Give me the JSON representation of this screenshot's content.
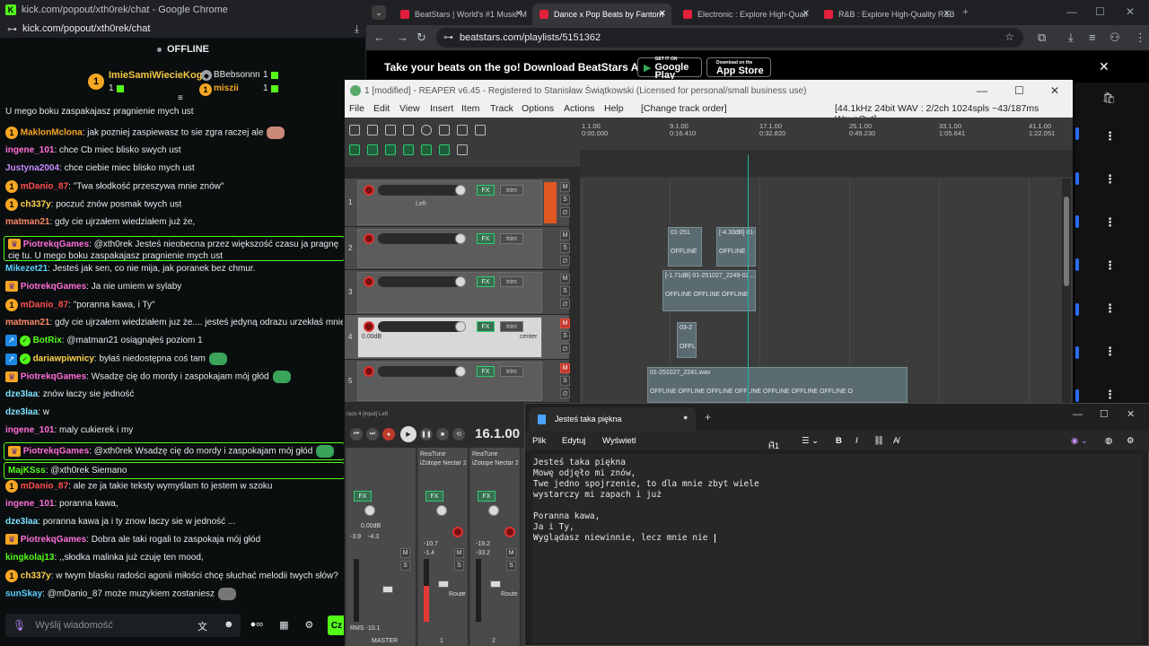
{
  "chat_window": {
    "title": "kick.com/popout/xth0rek/chat - Google Chrome",
    "url": "kick.com/popout/xth0rek/chat",
    "status": "OFFLINE",
    "top_gifters": [
      {
        "rank": "1",
        "name": "ImieSamiWiecieKogo",
        "count": "1"
      },
      {
        "rank": "",
        "name": "BBebsonnn",
        "count": "1"
      },
      {
        "rank": "",
        "name": "miszii",
        "count": "1"
      }
    ],
    "messages": [
      {
        "user": "",
        "text": "U mego boku zaspakajasz pragnienie mych ust",
        "color": "#e8eaed",
        "badge": ""
      },
      {
        "user": "MaklonMclona",
        "text": ": jak pozniej zaspiewasz to sie zgra raczej ale",
        "color": "#f5a623",
        "badge": "coin"
      },
      {
        "user": "ingene_101",
        "text": ": chce Cb miec blisko swych ust",
        "color": "#ff6fd8",
        "badge": ""
      },
      {
        "user": "Justyna2004",
        "text": ": chce ciebie miec blisko mych ust",
        "color": "#c38cff",
        "badge": ""
      },
      {
        "user": "mDanio_87",
        "text": ": \"Twa słodkość przeszywa mnie znów\"",
        "color": "#ff4d4d",
        "badge": "coin"
      },
      {
        "user": "ch337y",
        "text": ": poczuć znów posmak twych ust",
        "color": "#ffd54d",
        "badge": "coin"
      },
      {
        "user": "matman21",
        "text": ": gdy cie ujrzałem wiedziałem już że,",
        "color": "#ff8a65",
        "badge": ""
      },
      {
        "user": "PiotrekqGames",
        "text": ": @xth0rek Jesteś nieobecna przez większość czasu ja pragnę cię tu. U mego boku zaspakajasz pragnienie mych ust",
        "color": "#ff6fd8",
        "badge": "crown"
      },
      {
        "user": "Mikezet21",
        "text": ": Jesteś jak sen, co nie mija, jak poranek bez chmur.",
        "color": "#5ad1ff",
        "badge": ""
      },
      {
        "user": "PiotrekqGames",
        "text": ": Ja nie umiem w sylaby",
        "color": "#ff6fd8",
        "badge": "crown"
      },
      {
        "user": "mDanio_87",
        "text": ": \"poranna kawa, i Ty\"",
        "color": "#ff4d4d",
        "badge": "coin"
      },
      {
        "user": "matman21",
        "text": ": gdy cie ujrzałem wiedziałem juz że.... jesteś jedyną odrazu urzekłaś mnie",
        "color": "#ff8a65",
        "badge": ""
      },
      {
        "user": "BotRix",
        "text": ": @matman21 osiągnąłeś poziom 1",
        "color": "#53fc18",
        "badge": "bot"
      },
      {
        "user": "dariawpiwnicy",
        "text": ": byłaś niedostępna coś tam",
        "color": "#ffd54d",
        "badge": "bot"
      },
      {
        "user": "PiotrekqGames",
        "text": ": Wsadzę cię do mordy i zaspokajam mój głód",
        "color": "#ff6fd8",
        "badge": "crown"
      },
      {
        "user": "dze3laa",
        "text": ": znów łaczy sie jedność",
        "color": "#7ee3ff",
        "badge": ""
      },
      {
        "user": "dze3laa",
        "text": ": w",
        "color": "#7ee3ff",
        "badge": ""
      },
      {
        "user": "ingene_101",
        "text": ": maly cukierek i my",
        "color": "#ff6fd8",
        "badge": ""
      },
      {
        "user": "PiotrekqGames",
        "text": ": @xth0rek Wsadzę cię do mordy i zaspokajam mój głód",
        "color": "#ff6fd8",
        "badge": "crown"
      },
      {
        "user": "MajKSss",
        "text": ": @xth0rek Siemano",
        "color": "#53fc18",
        "badge": ""
      },
      {
        "user": "mDanio_87",
        "text": ": ale ze ja takie teksty wymyślam to jestem w szoku",
        "color": "#ff4d4d",
        "badge": "coin"
      },
      {
        "user": "ingene_101",
        "text": ": poranna kawa,",
        "color": "#ff6fd8",
        "badge": ""
      },
      {
        "user": "dze3laa",
        "text": ": poranna kawa ja i ty znow laczy sie w jedność ...",
        "color": "#7ee3ff",
        "badge": ""
      },
      {
        "user": "PiotrekqGames",
        "text": ": Dobra ale taki rogali to zaspokaja mój głód",
        "color": "#ff6fd8",
        "badge": "crown"
      },
      {
        "user": "kingkolaj13",
        "text": ": ,,słodka malinka już czuję ten mood,",
        "color": "#53fc18",
        "badge": ""
      },
      {
        "user": "ch337y",
        "text": ": w twym blasku radości agonii miłości chcę słuchać melodii twych słów?",
        "color": "#ffd54d",
        "badge": "coin"
      },
      {
        "user": "sunSkay",
        "text": ": @mDanio_87 może muzykiem zostaniesz",
        "color": "#5ad1ff",
        "badge": ""
      }
    ],
    "input_placeholder": "Wyślij wiadomość",
    "send_label": "Cz"
  },
  "browser": {
    "tabs": [
      {
        "label": "BeatStars | World's #1 Music M"
      },
      {
        "label": "Dance x Pop Beats by Fantom"
      },
      {
        "label": "Electronic : Explore High-Quali"
      },
      {
        "label": "R&B : Explore High-Quality R&B"
      }
    ],
    "url": "beatstars.com/playlists/5151362",
    "promo_text": "Take your beats on the go! Download BeatStars App",
    "google_play": {
      "small": "GET IT ON",
      "big": "Google Play"
    },
    "app_store": {
      "small": "Download on the",
      "big": "App Store"
    }
  },
  "reaper": {
    "title": "1 [modified] - REAPER v6.45 - Registered to Stanisław Świątkowski (Licensed for personal/small business use)",
    "menu": [
      "File",
      "Edit",
      "View",
      "Insert",
      "Item",
      "Track",
      "Options",
      "Actions",
      "Help",
      "[Change track order]"
    ],
    "status": "[44.1kHz 24bit WAV : 2/2ch 1024spls ~43/187ms WaveOut]",
    "ruler": [
      {
        "bar": "1.1.00",
        "time": "0:00.000"
      },
      {
        "bar": "9.1.00",
        "time": "0:16.410"
      },
      {
        "bar": "17.1.00",
        "time": "0:32.820"
      },
      {
        "bar": "25.1.00",
        "time": "0:49.230"
      },
      {
        "bar": "33.1.00",
        "time": "1:05.641"
      },
      {
        "bar": "41.1.00",
        "time": "1:22.051"
      }
    ],
    "tracks": [
      {
        "num": "1",
        "pan": "Left",
        "vol": ""
      },
      {
        "num": "2",
        "pan": "",
        "vol": ""
      },
      {
        "num": "3",
        "pan": "",
        "vol": ""
      },
      {
        "num": "4",
        "pan": "center",
        "vol": "0.00dB"
      },
      {
        "num": "5",
        "pan": "",
        "vol": ""
      }
    ],
    "items": [
      {
        "label": "01-251",
        "off": "OFFLINE"
      },
      {
        "label": "[-4.33dB] 01-",
        "off": "OFFLINE"
      },
      {
        "label": "[-1.71dB] 01-251027_2249-02...",
        "off": "OFFLINE   OFFLINE   OFFLINE"
      },
      {
        "label": "03-2",
        "off": "OFFL"
      },
      {
        "label": "01-251027_2241.wav",
        "off": "OFFLINE   OFFLINE   OFFLINE   OFFLINE   OFFLINE   OFFLINE   OFFLINE   O"
      }
    ],
    "fx_label": "FX",
    "trim_label": "trim",
    "time_display": "16.1.00",
    "transport_status": "rack 4 [input] Left",
    "mixer": {
      "strips": [
        {
          "name": "MASTER",
          "db": "0.00dB",
          "l": "-3.9",
          "r": "-4.3",
          "rms": "RMS",
          "rmsv": "-10.1"
        },
        {
          "name": "1",
          "plugin1": "ReaTune",
          "plugin2": "iZotope Nectar 2",
          "db": "-10.7",
          "r": "-1.4"
        },
        {
          "name": "2",
          "plugin1": "ReaTune",
          "plugin2": "iZotope Nectar 2",
          "db": "-19.2",
          "r": "-33.2"
        }
      ],
      "route": "Route"
    }
  },
  "notepad": {
    "tab_title": "Jesteś taka piękna",
    "menu": [
      "Plik",
      "Edytuj",
      "Wyświetl"
    ],
    "heading": "H1",
    "lines": [
      "Jesteś taka piękna",
      "Mowę odjęło mi znów,",
      "Twe jedno spojrzenie, to dla mnie zbyt wiele",
      "wystarczy mi zapach i już",
      "",
      "Poranna kawa,",
      "Ja i Ty,",
      "Wyglądasz niewinnie, lecz mnie nie "
    ]
  }
}
